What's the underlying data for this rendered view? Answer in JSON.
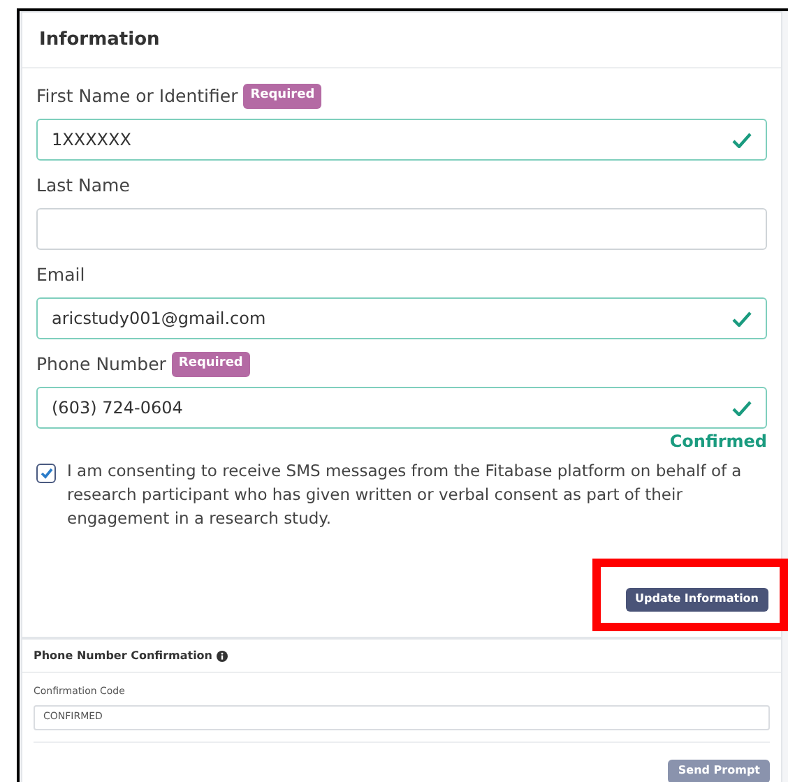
{
  "information": {
    "title": "Information",
    "fields": [
      {
        "label": "First Name or Identifier",
        "badge": "Required",
        "value": "1XXXXXX",
        "valid": true
      },
      {
        "label": "Last Name",
        "valid": false
      },
      {
        "label": "Email",
        "value": "aricstudy001@gmail.com",
        "valid": true
      },
      {
        "label": "Phone Number",
        "badge": "Required",
        "value": "(603) 724-0604",
        "valid": true,
        "status": "Confirmed"
      }
    ],
    "consent": {
      "checked": true,
      "text": "I am consenting to receive SMS messages from the Fitabase platform on behalf of a research participant who has given written or verbal consent as part of their engagement in a research study."
    },
    "button": {
      "label": "Update Information",
      "highlighted": true
    }
  },
  "confirmation": {
    "title": "Phone Number Confirmation",
    "field": {
      "label": "Confirmation Code",
      "value": "CONFIRMED"
    },
    "button": {
      "label": "Send Prompt",
      "disabled": true
    }
  }
}
